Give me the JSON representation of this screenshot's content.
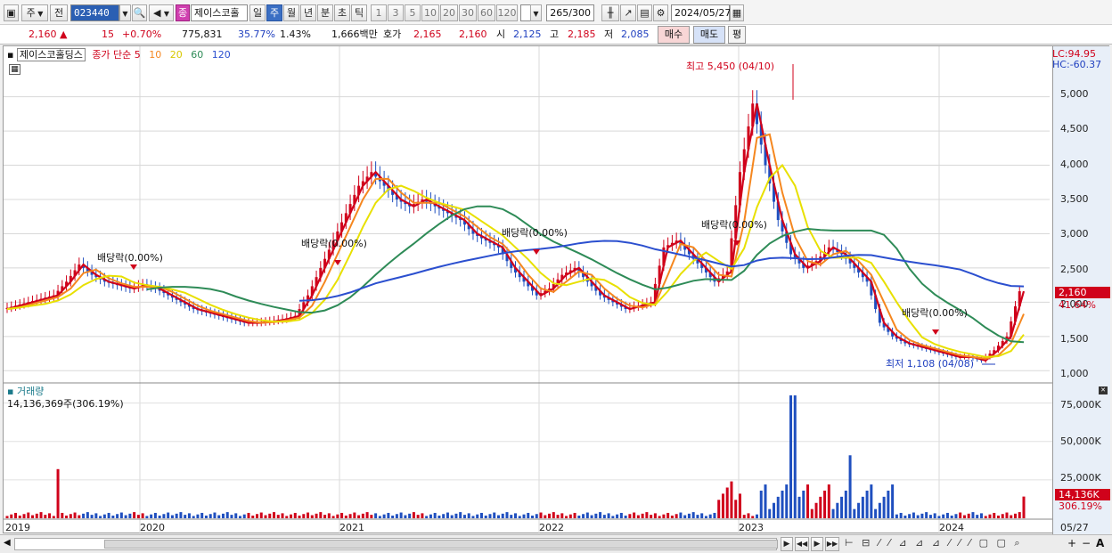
{
  "toolbar": {
    "market": "주",
    "type": "전",
    "code": "023440",
    "stock_chip": "종",
    "stock_name": "제이스코홀",
    "periods": [
      "일",
      "주",
      "월",
      "년",
      "분",
      "초",
      "틱"
    ],
    "active_period": "주",
    "intervals": [
      "1",
      "3",
      "5",
      "10",
      "20",
      "30",
      "60",
      "120"
    ],
    "count": "265",
    "count_total": "/300",
    "date": "2024/05/27"
  },
  "quote": {
    "price": "2,160",
    "arrow": "▲",
    "change": "15",
    "change_pct": "+0.70%",
    "volume": "775,831",
    "turnover_pct": "35.77%",
    "vol_ratio": "1.43%",
    "amount": "1,666백만",
    "bidask_label": "호가",
    "ask": "2,165",
    "bid": "2,160",
    "open_label": "시",
    "open": "2,125",
    "high_label": "고",
    "high": "2,185",
    "low_label": "저",
    "low": "2,085",
    "buy_btn": "매수",
    "sell_btn": "매도",
    "eval_btn": "평"
  },
  "legend": {
    "name": "제이스코홀딩스",
    "title": "종가 단순",
    "ma": [
      "5",
      "10",
      "20",
      "60",
      "120"
    ],
    "ma_colors": [
      "#d0021b",
      "#f5871f",
      "#e8e000",
      "#2e8b57",
      "#2b4fcf"
    ]
  },
  "price_pane": {
    "lc": "LC:94.95",
    "hc": "HC:-60.37",
    "y_ticks": [
      "5,000",
      "4,500",
      "4,000",
      "3,500",
      "3,000",
      "2,500",
      "2,000",
      "1,500",
      "1,000"
    ],
    "current_price": "2,160",
    "current_pct": "41.64%",
    "high_note": "최고 5,450 (04/10)",
    "low_note": "최저 1,108 (04/08)",
    "dividend_notes": [
      "배당락(0.00%)",
      "배당락(0.00%)",
      "배당락(0.00%)",
      "배당락(0.00%)",
      "배당락(0.00%)"
    ]
  },
  "volume_pane": {
    "title": "거래량",
    "value": "14,136,369주(306.19%)",
    "y_ticks": [
      "75,000K",
      "50,000K",
      "25,000K"
    ],
    "current": "14,136K",
    "current_pct": "306.19%"
  },
  "x_axis": [
    "2019",
    "2020",
    "2021",
    "2022",
    "2023",
    "2024",
    "05/27"
  ],
  "chart_data": {
    "type": "candlestick",
    "ylim": [
      900,
      5450
    ],
    "y_ticks": [
      1000,
      1500,
      2000,
      2500,
      3000,
      3500,
      4000,
      4500,
      5000
    ],
    "close_series": [
      1900,
      1950,
      2000,
      2050,
      2100,
      2300,
      2550,
      2400,
      2300,
      2250,
      2200,
      2250,
      2200,
      2100,
      2000,
      1900,
      1850,
      1800,
      1750,
      1700,
      1700,
      1720,
      1750,
      1800,
      2100,
      2500,
      2900,
      3300,
      3700,
      3900,
      3700,
      3500,
      3400,
      3500,
      3400,
      3300,
      3200,
      3000,
      2900,
      2800,
      2500,
      2300,
      2100,
      2200,
      2400,
      2500,
      2300,
      2100,
      2000,
      1900,
      1950,
      2000,
      2800,
      2900,
      2700,
      2500,
      2300,
      2450,
      3900,
      4900,
      4000,
      3200,
      2700,
      2500,
      2600,
      2800,
      2700,
      2500,
      2300,
      1700,
      1500,
      1400,
      1350,
      1300,
      1250,
      1200,
      1200,
      1150,
      1300,
      1500,
      2160
    ],
    "volume_units": "K shares",
    "volume_peak": 80000,
    "volume_ticks": [
      25000,
      50000,
      75000
    ],
    "last_volume": 14136
  },
  "bottom": {
    "nav": [
      "▶",
      "◀◀",
      "▶",
      "▶▶"
    ],
    "tools": [
      "+",
      "−",
      "A"
    ]
  }
}
